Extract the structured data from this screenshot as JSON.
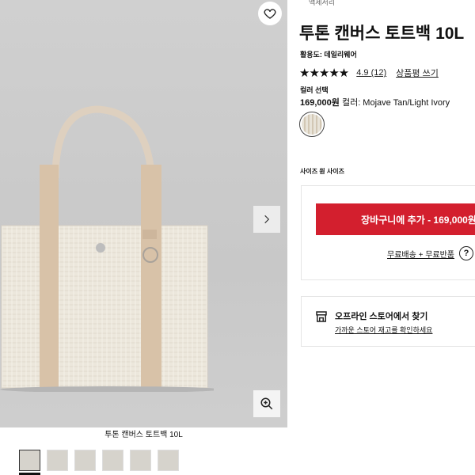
{
  "gallery": {
    "caption": "투톤 캔버스 토트백 10L",
    "thumbnails": [
      "thumb-1",
      "thumb-2",
      "thumb-3",
      "thumb-4",
      "thumb-5",
      "thumb-6"
    ]
  },
  "product": {
    "breadcrumb": "액세서리",
    "title": "투톤 캔버스 토트백 10L",
    "activity": "활용도: 데일리웨어",
    "stars": "★★★★★",
    "rating": "4.9",
    "review_count": "(12)",
    "write_review": "상품평 쓰기",
    "color_select_label": "컬러 선택",
    "price": "169,000원",
    "color_text": "컬러: Mojave Tan/Light Ivory",
    "size_label": "사이즈 원 사이즈"
  },
  "cart": {
    "add_to_cart": "장바구니에 추가 - 169,000원",
    "shipping": "무료배송 + 무료반품",
    "help": "?"
  },
  "store": {
    "title": "오프라인 스토어에서 찾기",
    "link": "가까운 스토어 재고를 확인하세요"
  },
  "colors": {
    "cart_button": "#d31f2e",
    "bag_body": "#ece7dc",
    "bag_strap": "#d8c2a8"
  }
}
